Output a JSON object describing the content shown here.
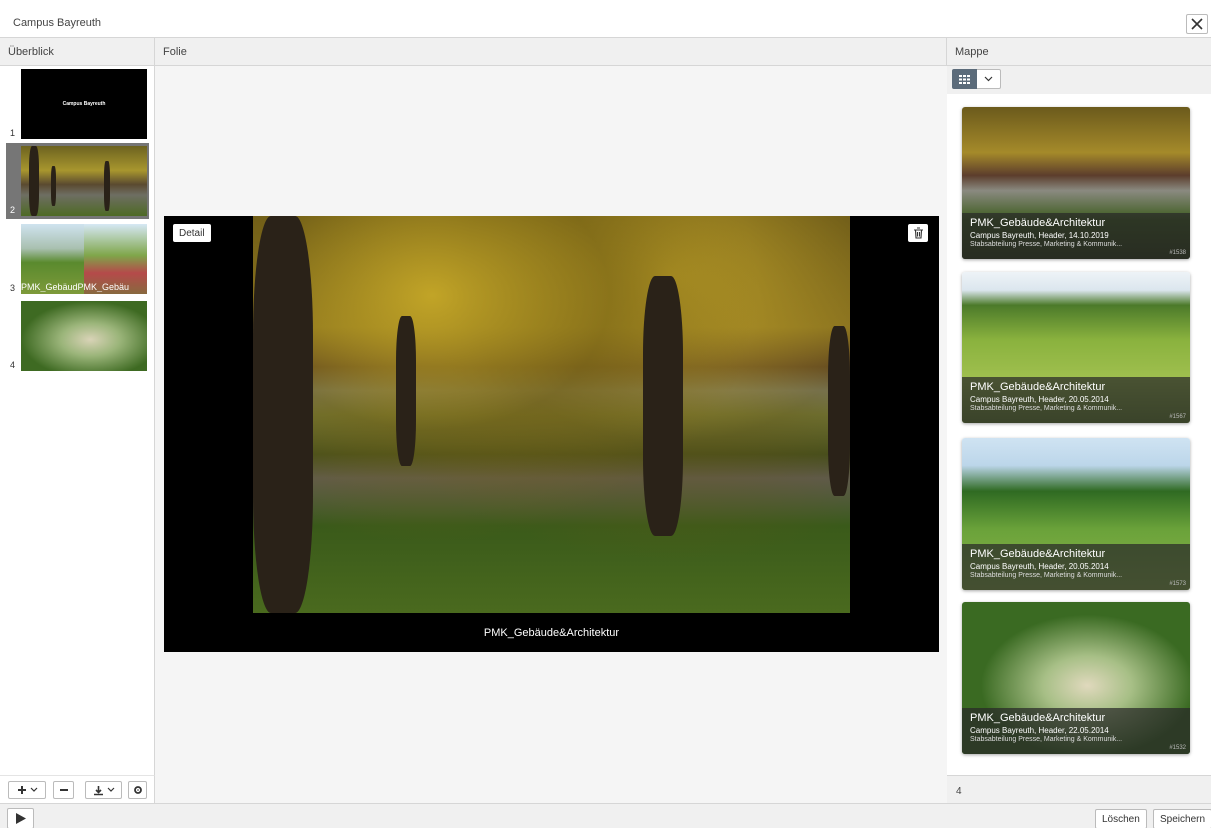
{
  "window": {
    "title": "Campus Bayreuth"
  },
  "columns": {
    "left": "Überblick",
    "middle": "Folie",
    "right": "Mappe"
  },
  "overview": {
    "slides": [
      {
        "number": "1",
        "caption": "Campus Bayreuth"
      },
      {
        "number": "2"
      },
      {
        "number": "3",
        "caption": "PMK_GebäudPMK_Gebäu"
      },
      {
        "number": "4"
      }
    ],
    "selected_index": 2
  },
  "stage": {
    "detail_label": "Detail",
    "caption": "PMK_Gebäude&Architektur"
  },
  "mappe": {
    "cards": [
      {
        "title": "PMK_Gebäude&Architektur",
        "sub": "Campus Bayreuth, Header, 14.10.2019",
        "org": "Stabsabteilung Presse, Marketing & Kommunik...",
        "id": "#1538"
      },
      {
        "title": "PMK_Gebäude&Architektur",
        "sub": "Campus Bayreuth, Header, 20.05.2014",
        "org": "Stabsabteilung Presse, Marketing & Kommunik...",
        "id": "#1567"
      },
      {
        "title": "PMK_Gebäude&Architektur",
        "sub": "Campus Bayreuth, Header, 20.05.2014",
        "org": "Stabsabteilung Presse, Marketing & Kommunik...",
        "id": "#1573"
      },
      {
        "title": "PMK_Gebäude&Architektur",
        "sub": "Campus Bayreuth, Header, 22.05.2014",
        "org": "Stabsabteilung Presse, Marketing & Kommunik...",
        "id": "#1532"
      }
    ],
    "count": "4"
  },
  "footer": {
    "delete_label": "Löschen",
    "save_label": "Speichern"
  },
  "icons": {
    "close": "close-icon",
    "plus": "plus-icon",
    "minus": "minus-icon",
    "download": "download-icon",
    "gear": "gear-icon",
    "grid": "grid-icon",
    "chevron": "chevron-down-icon",
    "trash": "trash-icon",
    "play": "play-icon"
  },
  "colors": {
    "selected": "#767676",
    "toggle_active": "#5b6b7a"
  }
}
